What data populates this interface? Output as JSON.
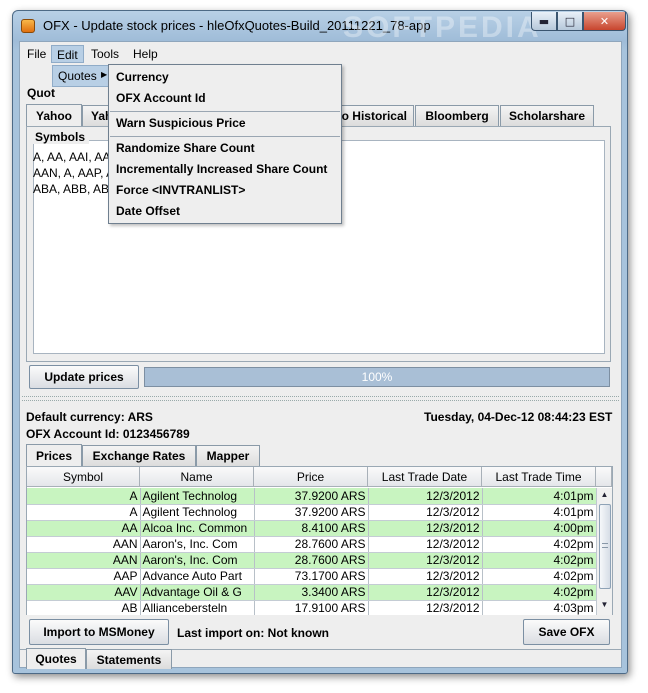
{
  "window": {
    "title": "OFX - Update stock prices - hleOfxQuotes-Build_20111221_78-app",
    "watermark": "SOFTPEDIA"
  },
  "menubar": {
    "items": [
      "File",
      "Edit",
      "Tools",
      "Help"
    ]
  },
  "quotes_label": "Quot",
  "quotes_submenu_label": "Quotes",
  "source_tabs": {
    "items": [
      "Yahoo",
      "Yah",
      "o Historical",
      "Bloomberg",
      "Scholarshare"
    ],
    "selected": "Yahoo"
  },
  "symbols": {
    "label": "Symbols",
    "lines": [
      "A, AA, AAI, AAN",
      "AAN, A, AAP, A",
      "ABA, ABB, ABC"
    ]
  },
  "update_button": "Update prices",
  "progress": {
    "text": "100%",
    "value": 100
  },
  "edit_menu": {
    "group1": [
      "Currency",
      "OFX Account Id"
    ],
    "group2": [
      "Warn Suspicious Price"
    ],
    "group3": [
      "Randomize Share Count",
      "Incrementally Increased Share Count",
      "Force <INVTRANLIST>",
      "Date Offset"
    ]
  },
  "info": {
    "default_currency": "Default currency: ARS",
    "account_id": "OFX Account Id: 0123456789",
    "datetime": "Tuesday, 04-Dec-12 08:44:23 EST"
  },
  "result_tabs": {
    "items": [
      "Prices",
      "Exchange Rates",
      "Mapper"
    ],
    "selected": "Prices"
  },
  "table": {
    "columns": [
      "Symbol",
      "Name",
      "Price",
      "Last Trade Date",
      "Last Trade Time"
    ],
    "rows": [
      [
        "A",
        "Agilent Technolog",
        "37.9200 ARS",
        "12/3/2012",
        "4:01pm"
      ],
      [
        "A",
        "Agilent Technolog",
        "37.9200 ARS",
        "12/3/2012",
        "4:01pm"
      ],
      [
        "AA",
        "Alcoa Inc. Common",
        "8.4100 ARS",
        "12/3/2012",
        "4:00pm"
      ],
      [
        "AAN",
        "Aaron's, Inc. Com",
        "28.7600 ARS",
        "12/3/2012",
        "4:02pm"
      ],
      [
        "AAN",
        "Aaron's, Inc. Com",
        "28.7600 ARS",
        "12/3/2012",
        "4:02pm"
      ],
      [
        "AAP",
        "Advance Auto Part",
        "73.1700 ARS",
        "12/3/2012",
        "4:02pm"
      ],
      [
        "AAV",
        "Advantage Oil & G",
        "3.3400 ARS",
        "12/3/2012",
        "4:02pm"
      ],
      [
        "AB",
        "Alliancebersteln",
        "17.9100 ARS",
        "12/3/2012",
        "4:03pm"
      ]
    ],
    "row_colors": {
      "highlight": "#c8f4c0",
      "normal": "#ffffff"
    }
  },
  "import_button": "Import to MSMoney",
  "last_import": "Last import on: Not known",
  "save_button": "Save OFX",
  "bottom_tabs": {
    "items": [
      "Quotes",
      "Statements"
    ],
    "selected": "Quotes"
  },
  "colors": {
    "menu_highlight": "#b8cfe5",
    "progress": "#a9bfd6",
    "window_frame": "#9fbcd8"
  }
}
